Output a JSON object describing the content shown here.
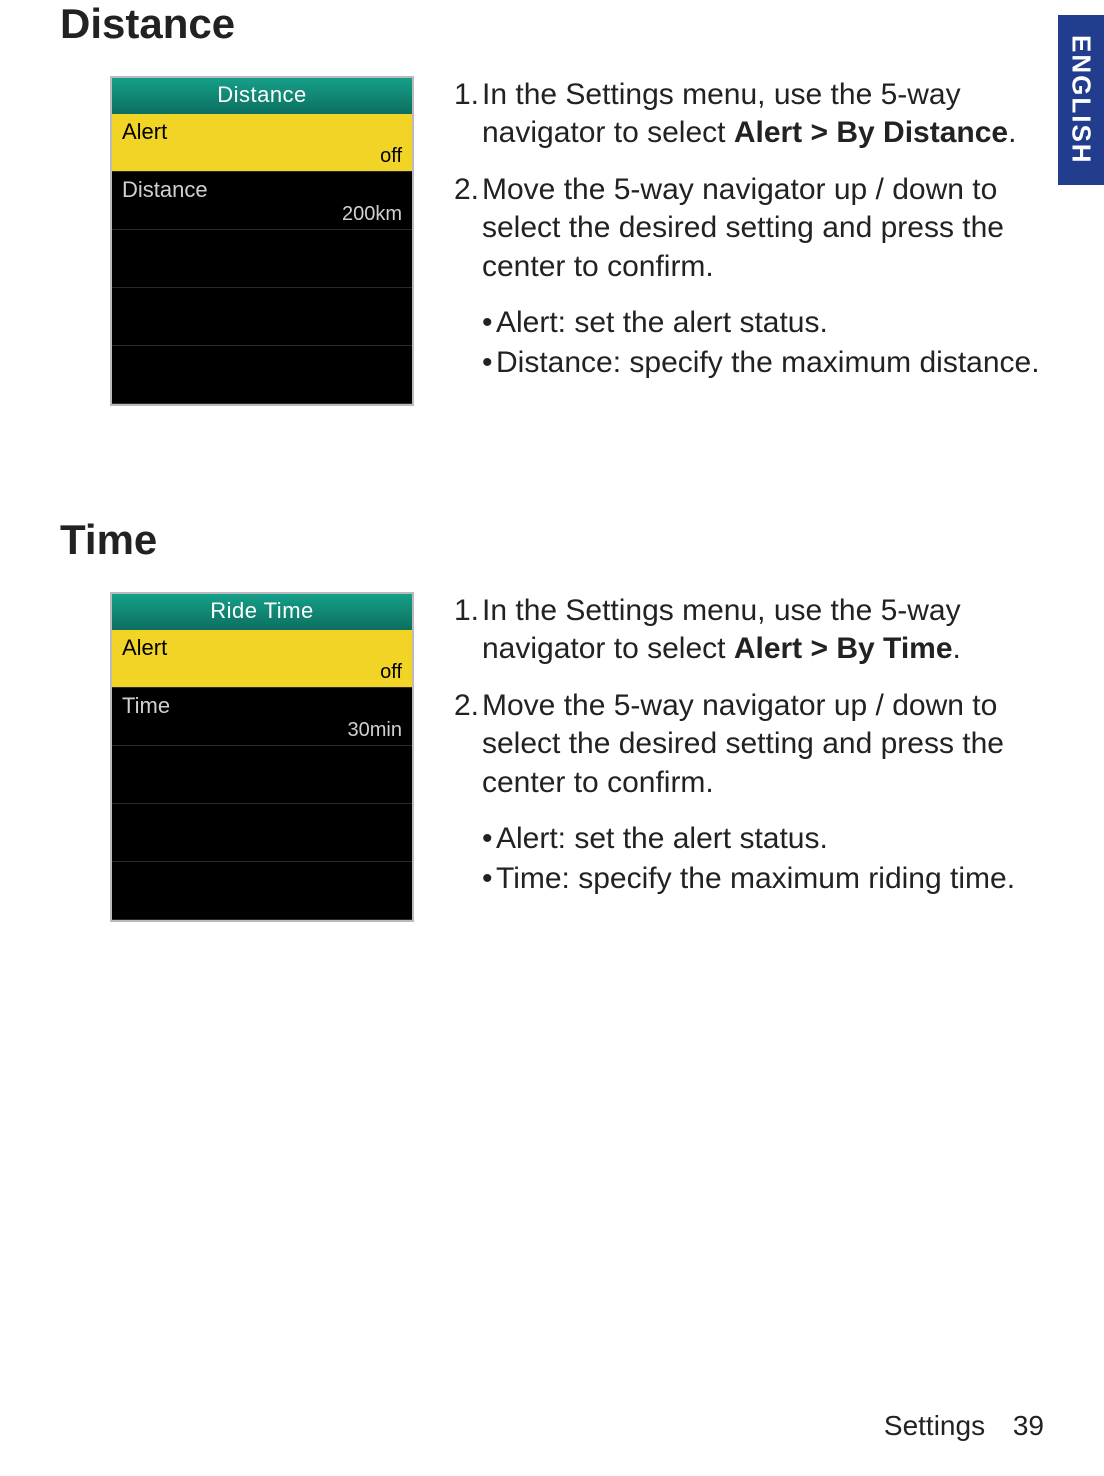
{
  "language_tab": "ENGLISH",
  "sections": {
    "distance": {
      "heading": "Distance",
      "device": {
        "title": "Distance",
        "rows": [
          {
            "label": "Alert",
            "value": "off",
            "selected": true
          },
          {
            "label": "Distance",
            "value": "200km",
            "selected": false
          }
        ]
      },
      "steps": [
        {
          "num": "1.",
          "pre": "In the Settings menu, use the 5-way navigator to select ",
          "bold": "Alert > By Distance",
          "post": "."
        },
        {
          "num": "2.",
          "pre": "Move the 5-way navigator up / down to select the desired setting and press the center to confirm.",
          "bold": "",
          "post": ""
        }
      ],
      "bullets": [
        "Alert: set the alert status.",
        "Distance: specify the maximum distance."
      ]
    },
    "time": {
      "heading": "Time",
      "device": {
        "title": "Ride Time",
        "rows": [
          {
            "label": "Alert",
            "value": "off",
            "selected": true
          },
          {
            "label": "Time",
            "value": "30min",
            "selected": false
          }
        ]
      },
      "steps": [
        {
          "num": "1.",
          "pre": "In the Settings menu, use the 5-way navigator to select ",
          "bold": "Alert > By Time",
          "post": "."
        },
        {
          "num": "2.",
          "pre": "Move the 5-way navigator up / down to select the desired setting and press the center to confirm.",
          "bold": "",
          "post": ""
        }
      ],
      "bullets": [
        "Alert: set the alert status.",
        "Time: specify the maximum riding time."
      ]
    }
  },
  "footer": {
    "section": "Settings",
    "page": "39"
  }
}
